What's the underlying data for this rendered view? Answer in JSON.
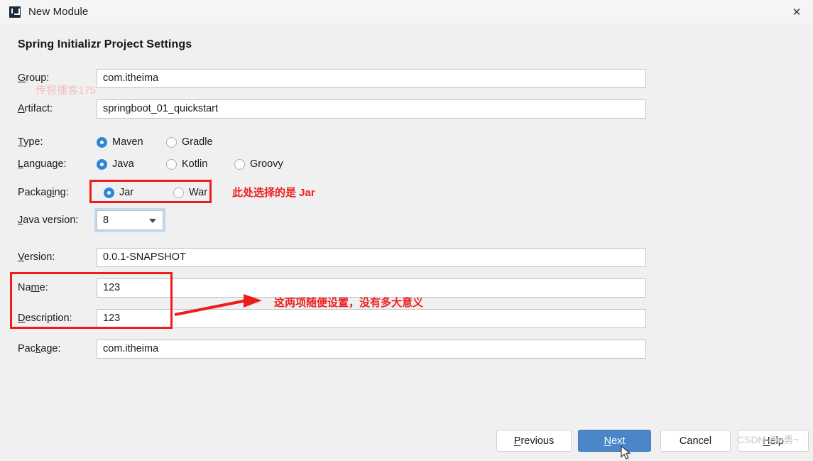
{
  "window": {
    "title": "New Module",
    "icon": "intellij-idea-icon",
    "close_label": "✕"
  },
  "dialog": {
    "heading": "Spring Initializr Project Settings"
  },
  "form": {
    "group": {
      "label": "Group:",
      "mnemonic": "G",
      "value": "com.itheima"
    },
    "artifact": {
      "label": "Artifact:",
      "mnemonic": "A",
      "value": "springboot_01_quickstart"
    },
    "type": {
      "label": "Type:",
      "mnemonic": "T",
      "options": [
        "Maven",
        "Gradle"
      ],
      "selected": "Maven"
    },
    "language": {
      "label": "Language:",
      "mnemonic": "L",
      "options": [
        "Java",
        "Kotlin",
        "Groovy"
      ],
      "selected": "Java"
    },
    "packaging": {
      "label": "Packaging:",
      "mnemonic": "i",
      "options": [
        "Jar",
        "War"
      ],
      "selected": "Jar"
    },
    "java_version": {
      "label": "Java version:",
      "mnemonic": "J",
      "value": "8"
    },
    "version": {
      "label": "Version:",
      "mnemonic": "V",
      "value": "0.0.1-SNAPSHOT"
    },
    "name": {
      "label": "Name:",
      "mnemonic": "m",
      "value": "123"
    },
    "description": {
      "label": "Description:",
      "mnemonic": "D",
      "value": "123"
    },
    "package": {
      "label": "Package:",
      "mnemonic": "k",
      "value": "com.itheima"
    }
  },
  "annotations": {
    "packaging_note": "此处选择的是 Jar",
    "name_desc_note": "这两项随便设置，没有多大意义",
    "color": "#ee2020"
  },
  "watermarks": {
    "top_left": "传智播客175",
    "bottom_right": "CSDN @е勇~"
  },
  "footer": {
    "previous": "Previous",
    "next": "Next",
    "cancel": "Cancel",
    "help": "Help",
    "primary_color": "#4a86c8"
  }
}
